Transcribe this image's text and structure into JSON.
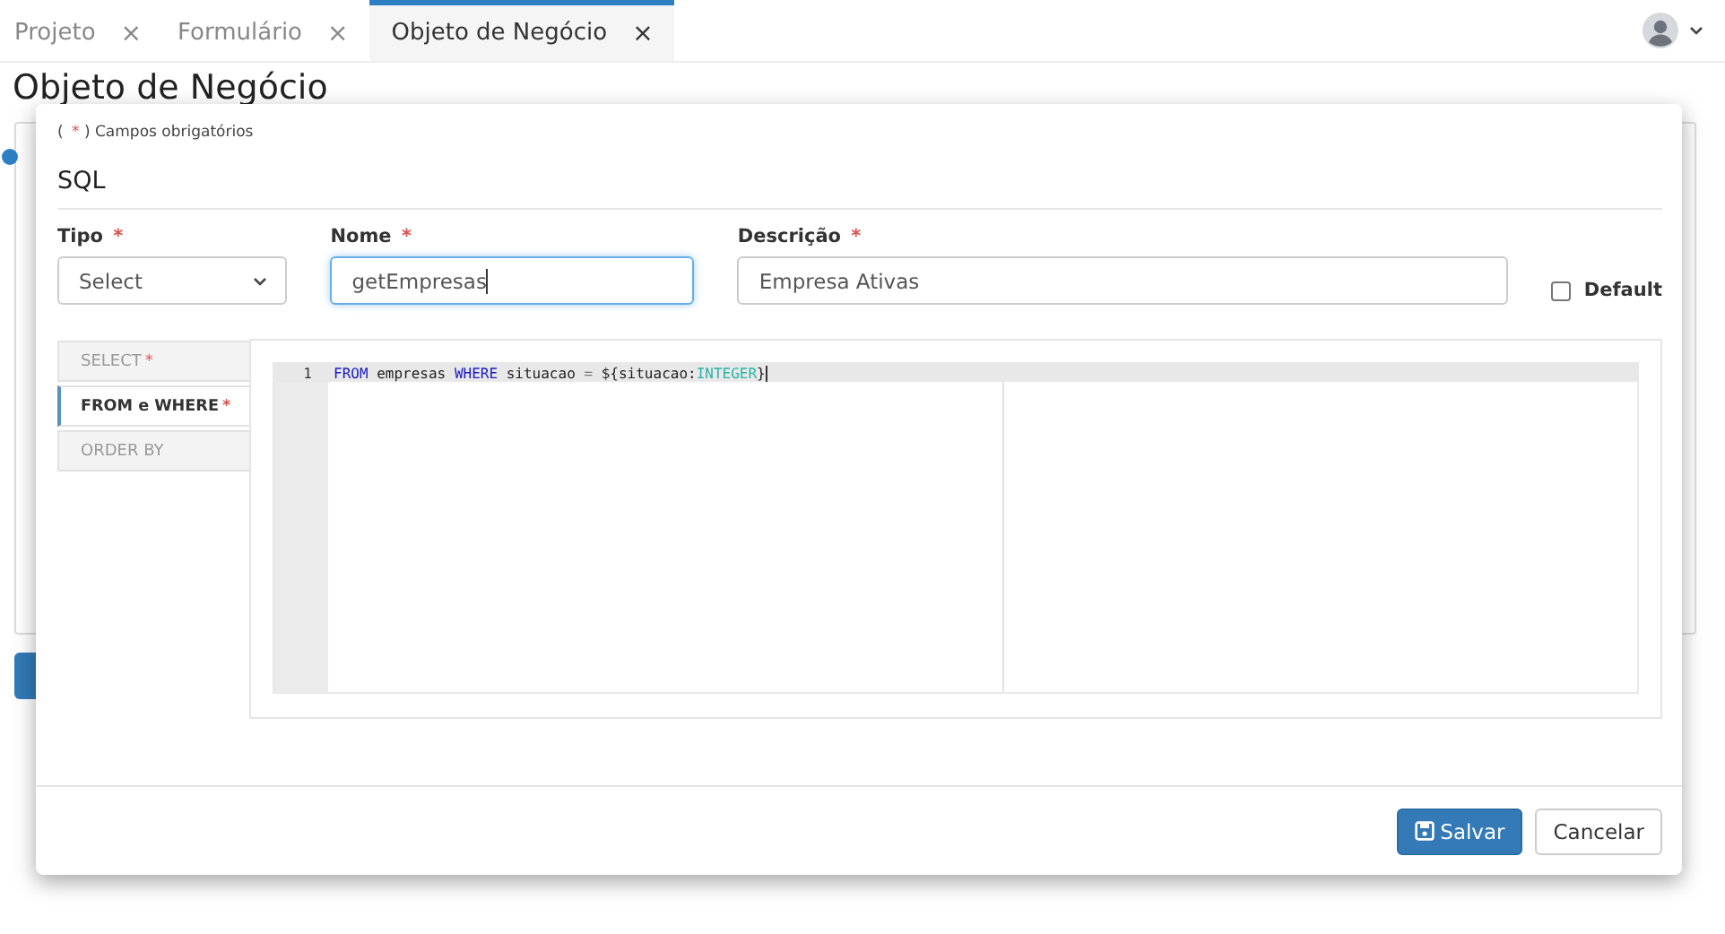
{
  "tabs": [
    {
      "label": "Projeto",
      "close": "×",
      "selected": false
    },
    {
      "label": "Formulário",
      "close": "×",
      "selected": false
    },
    {
      "label": "Objeto de Negócio",
      "close": "×",
      "selected": true
    }
  ],
  "page": {
    "title": "Objeto de Negócio"
  },
  "modal": {
    "note": {
      "open": "(",
      "mark": "*",
      "text": ") Campos obrigatórios"
    },
    "section_title": "SQL",
    "fields": [
      {
        "kind": "select",
        "label": "Tipo",
        "mark": "*",
        "value": "Select",
        "focused": false
      },
      {
        "kind": "text",
        "label": "Nome",
        "mark": "*",
        "value": "getEmpresas",
        "focused": true
      },
      {
        "kind": "text",
        "label": "Descrição",
        "mark": "*",
        "value": "Empresa Ativas",
        "focused": false
      }
    ],
    "default_checkbox": {
      "label": "Default",
      "checked": false
    },
    "side_tabs": [
      {
        "label": "SELECT",
        "mark": "*",
        "selected": false
      },
      {
        "label": "FROM e WHERE",
        "mark": "*",
        "selected": true
      },
      {
        "label": "ORDER BY",
        "selected": false
      }
    ],
    "editor": {
      "lines": [
        {
          "number": "1",
          "tokens": [
            {
              "kind": "keyword",
              "text": "FROM"
            },
            {
              "kind": "plain",
              "text": " empresas "
            },
            {
              "kind": "keyword",
              "text": "WHERE"
            },
            {
              "kind": "plain",
              "text": " situacao "
            },
            {
              "kind": "operator",
              "text": "="
            },
            {
              "kind": "plain",
              "text": " ${situacao:"
            },
            {
              "kind": "type",
              "text": "INTEGER"
            },
            {
              "kind": "plain",
              "text": "}"
            }
          ]
        }
      ]
    },
    "buttons": [
      {
        "kind": "primary",
        "label": "Salvar"
      },
      {
        "kind": "default",
        "label": "Cancelar"
      }
    ]
  }
}
